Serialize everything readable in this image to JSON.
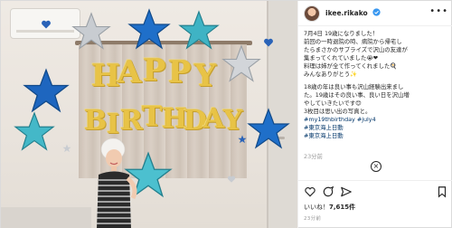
{
  "post": {
    "username": "ikee.rikako",
    "more_label": "•••",
    "caption_lines": [
      "7月4日 19歳になりました！",
      "前回の一時退院の時、病院から帰宅し",
      "たらまさかのサプライズで沢山の友達が",
      "集まってくれていました😭❤",
      "料理は姉が全て作ってくれました🍳",
      "みんなありがとう✨",
      "18歳の年は良い事も沢山経験出来まし",
      "た。19歳はその良い事、良い日を沢山増",
      "やしていきたいです😊",
      "3枚目は思い出の写真と。"
    ],
    "hashtags": [
      "#my19thbirthday #july4",
      "#東京海上日動",
      "#東京海上日動"
    ],
    "time_ago": "23分前",
    "likes_prefix": "いいね！",
    "likes_count": "7,615件",
    "date": "23分前"
  },
  "photo": {
    "row1": [
      "H",
      "A",
      "P",
      "P",
      "Y"
    ],
    "row2": [
      "B",
      "I",
      "R",
      "T",
      "H",
      "D",
      "A",
      "Y"
    ]
  }
}
